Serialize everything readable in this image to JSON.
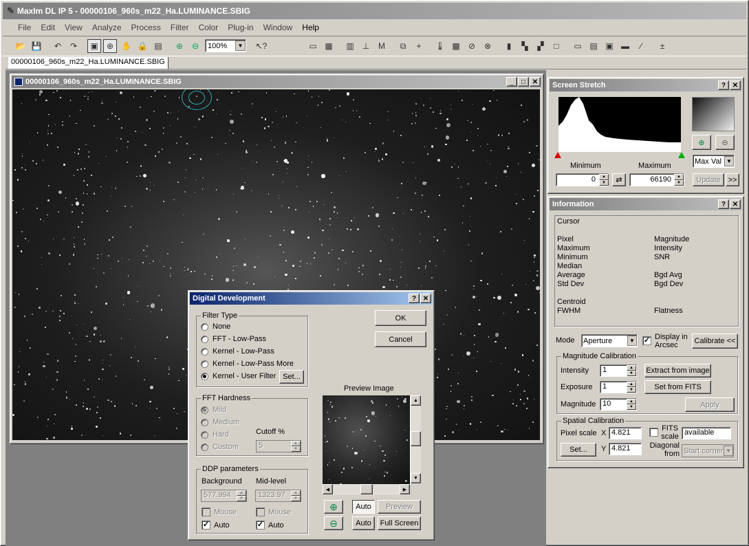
{
  "app": {
    "title": "MaxIm DL IP 5 - 00000106_960s_m22_Ha.LUMINANCE.SBIG"
  },
  "menu": [
    "File",
    "Edit",
    "View",
    "Analyze",
    "Process",
    "Filter",
    "Color",
    "Plug-in",
    "Window",
    "Help"
  ],
  "toolbar": {
    "zoom_value": "100%"
  },
  "doc_tab": {
    "label": "00000106_960s_m22_Ha.LUMINANCE.SBIG"
  },
  "image_window": {
    "title": "00000106_960s_m22_Ha.LUMINANCE.SBIG"
  },
  "screen_stretch": {
    "title": "Screen Stretch",
    "minimum_label": "Minimum",
    "maximum_label": "Maximum",
    "minimum_value": "0",
    "maximum_value": "66190",
    "mode_value": "Max Val",
    "update_label": "Update",
    "more_label": ">>"
  },
  "information": {
    "title": "Information",
    "cursor_label": "Cursor",
    "left_labels": [
      "Pixel",
      "Maximum",
      "Minimum",
      "Median",
      "Average",
      "Std Dev",
      "",
      "Centroid",
      "FWHM"
    ],
    "right_labels": [
      "Magnitude",
      "Intensity",
      "SNR",
      "",
      "Bgd Avg",
      "Bgd Dev",
      "",
      "",
      "Flatness"
    ],
    "mode_label": "Mode",
    "mode_value": "Aperture",
    "display_arcsec_label": "Display in Arcsec",
    "calibrate_label": "Calibrate <<",
    "mag_cal_group": "Magnitude Calibration",
    "intensity_label": "Intensity",
    "intensity_value": "1",
    "exposure_label": "Exposure",
    "exposure_value": "1",
    "magnitude_label": "Magnitude",
    "magnitude_value": "10",
    "extract_label": "Extract from image",
    "set_fits_label": "Set from FITS",
    "apply_label": "Apply",
    "spatial_group": "Spatial Calibration",
    "pixel_scale_label": "Pixel scale",
    "x_label": "X",
    "x_value": "4.821",
    "y_label": "Y",
    "y_value": "4.821",
    "set_label": "Set...",
    "fits_scale_label": "FITS scale",
    "available_value": "available",
    "diagonal_label": "Diagonal from",
    "start_corner_value": "Start corner"
  },
  "dialog": {
    "title": "Digital Development",
    "filter_type_group": "Filter Type",
    "filter_options": [
      "None",
      "FFT - Low-Pass",
      "Kernel - Low-Pass",
      "Kernel - Low-Pass More",
      "Kernel - User Filter"
    ],
    "selected_filter": 4,
    "set_label": "Set...",
    "ok_label": "OK",
    "cancel_label": "Cancel",
    "fft_group": "FFT Hardness",
    "fft_options": [
      "Mild",
      "Medium",
      "Hard",
      "Custom"
    ],
    "cutoff_label": "Cutoff %",
    "cutoff_value": "5",
    "ddp_group": "DDP parameters",
    "background_label": "Background",
    "background_value": "577.994",
    "midlevel_label": "Mid-level",
    "midlevel_value": "1323.97",
    "mouse_label": "Mouse",
    "auto_label": "Auto",
    "preview_label": "Preview Image",
    "auto_btn": "Auto",
    "preview_btn": "Preview",
    "auto_btn2": "Auto",
    "fullscreen_btn": "Full Screen"
  }
}
